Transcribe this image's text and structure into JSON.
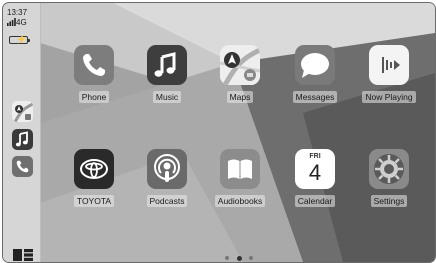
{
  "status": {
    "time": "13:37",
    "network": "4G"
  },
  "colors": {
    "wallpaper_light": "#c9c9c9",
    "wallpaper_dark": "#5f5f5f",
    "sidebar": "#d6d6d6"
  },
  "sidebar_apps": [
    {
      "name": "Maps",
      "icon": "maps-icon"
    },
    {
      "name": "Music",
      "icon": "music-note-icon"
    },
    {
      "name": "Phone",
      "icon": "phone-icon"
    }
  ],
  "apps": [
    {
      "label": "Phone",
      "icon": "phone-icon"
    },
    {
      "label": "Music",
      "icon": "music-note-icon"
    },
    {
      "label": "Maps",
      "icon": "maps-icon"
    },
    {
      "label": "Messages",
      "icon": "speech-bubble-icon"
    },
    {
      "label": "Now Playing",
      "icon": "now-playing-icon"
    },
    {
      "label": "TOYOTA",
      "icon": "toyota-logo-icon"
    },
    {
      "label": "Podcasts",
      "icon": "podcasts-icon"
    },
    {
      "label": "Audiobooks",
      "icon": "book-icon"
    },
    {
      "label": "Calendar",
      "icon": "calendar-icon",
      "day_name": "FRI",
      "day_number": "4"
    },
    {
      "label": "Settings",
      "icon": "gear-icon"
    }
  ],
  "pager": {
    "pages": 3,
    "current": 2
  }
}
